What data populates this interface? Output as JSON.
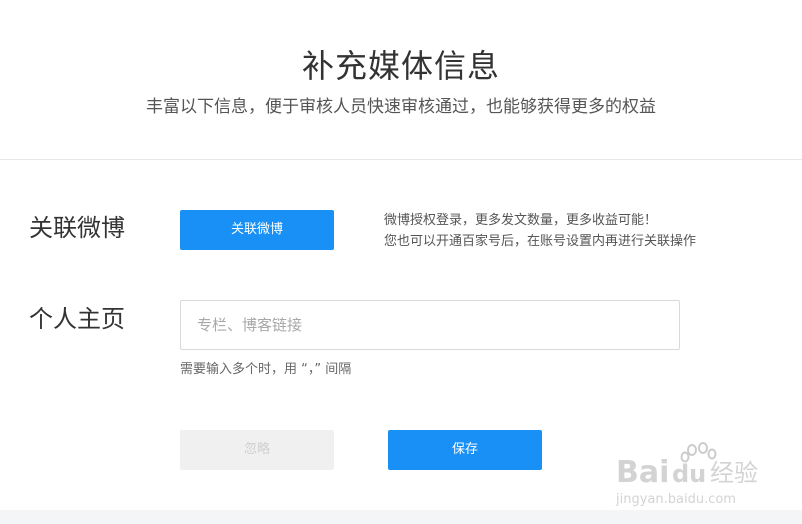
{
  "header": {
    "title": "补充媒体信息",
    "subtitle": "丰富以下信息，便于审核人员快速审核通过，也能够获得更多的权益"
  },
  "weibo": {
    "label": "关联微博",
    "button_label": "关联微博",
    "hint_line1": "微博授权登录，更多发文数量，更多收益可能！",
    "hint_line2": "您也可以开通百家号后，在账号设置内再进行关联操作"
  },
  "homepage": {
    "label": "个人主页",
    "input_value": "",
    "input_placeholder": "专栏、博客链接",
    "hint": "需要输入多个时，用 “，” 间隔"
  },
  "actions": {
    "ignore_label": "忽略",
    "save_label": "保存"
  },
  "watermark": {
    "brand": "Baidu经验",
    "url": "jingyan.baidu.com",
    "icon": "baidu-paw-icon"
  },
  "colors": {
    "primary": "#1890f5",
    "disabled_bg": "#f0f0f0",
    "text": "#333333"
  }
}
